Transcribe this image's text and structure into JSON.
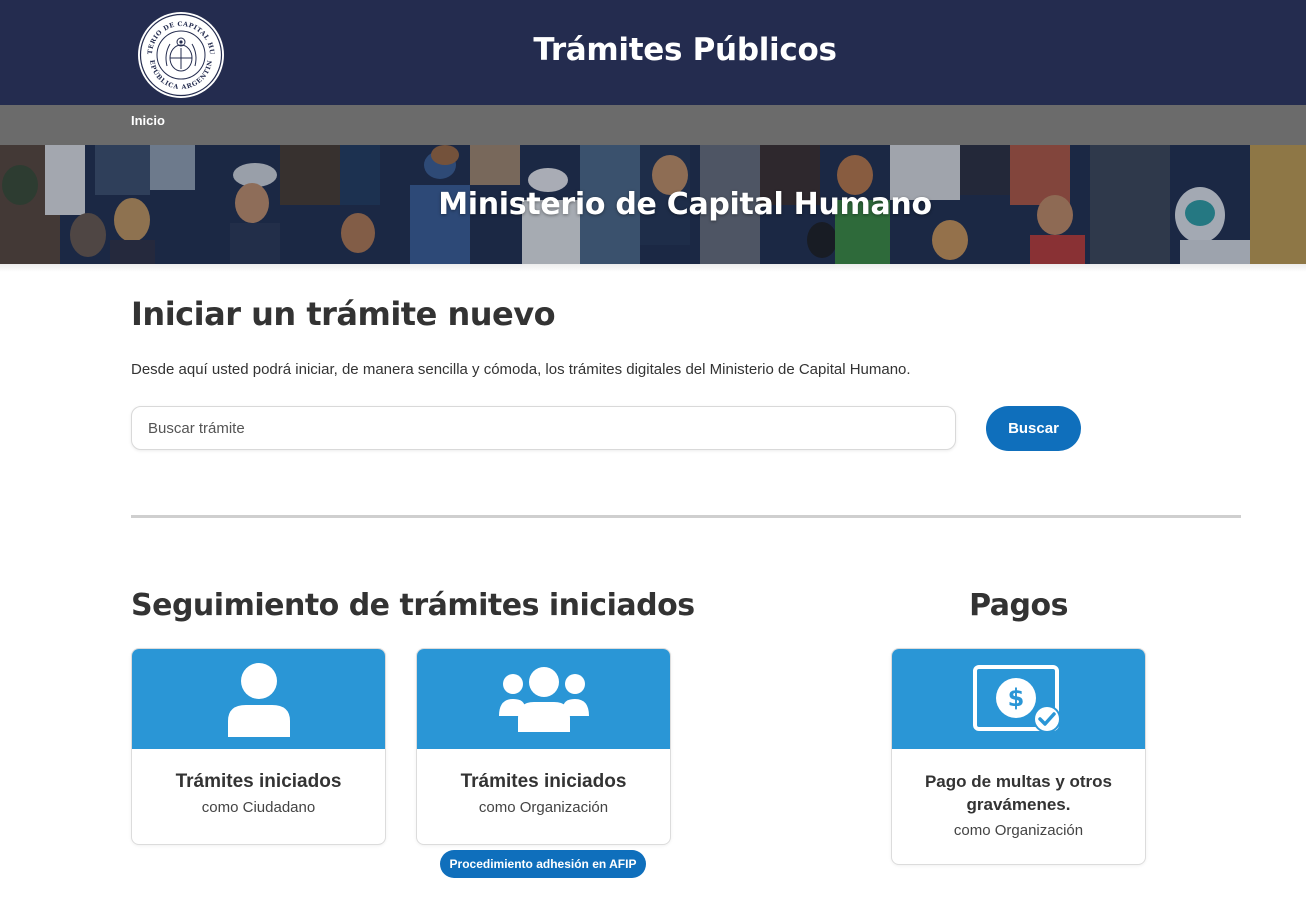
{
  "header": {
    "site_title": "Trámites Públicos",
    "seal_icon": "argentina-ministry-seal-icon",
    "seal_text_top": "MINISTERIO DE CAPITAL HUMANO",
    "seal_text_bottom": "REPÚBLICA ARGENTINA",
    "colors": {
      "header_bg": "#242c4f",
      "nav_bg": "#6b6b6b"
    }
  },
  "nav": {
    "home_label": "Inicio"
  },
  "banner": {
    "title": "Ministerio de Capital Humano"
  },
  "start": {
    "title": "Iniciar un trámite nuevo",
    "description": "Desde aquí usted podrá iniciar, de manera sencilla y cómoda, los trámites digitales del Ministerio de Capital Humano.",
    "search_placeholder": "Buscar trámite",
    "search_button": "Buscar"
  },
  "tracking": {
    "title": "Seguimiento de trámites iniciados",
    "cards": [
      {
        "icon": "user-icon",
        "title": "Trámites iniciados",
        "subtitle": "como Ciudadano"
      },
      {
        "icon": "group-icon",
        "title": "Trámites iniciados",
        "subtitle": "como Organización"
      }
    ],
    "afip_link": "Procedimiento adhesión en AFIP"
  },
  "payments": {
    "title": "Pagos",
    "card": {
      "icon": "payment-check-icon",
      "title": "Pago de multas y otros gravámenes.",
      "subtitle": "como Organización"
    }
  },
  "colors": {
    "accent": "#0f6fbc",
    "card_header": "#2a96d6"
  }
}
